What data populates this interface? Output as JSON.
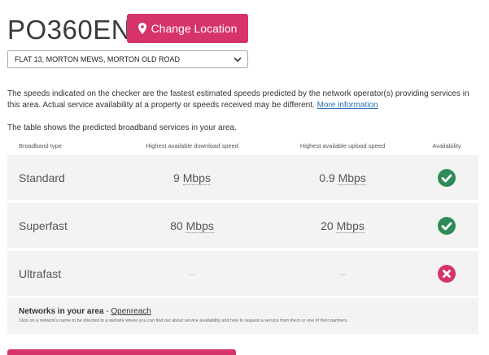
{
  "header": {
    "postcode": "PO360EN",
    "change_location_label": "Change Location",
    "address_selected": "FLAT 13, MORTON MEWS, MORTON OLD ROAD"
  },
  "info": {
    "text": "The speeds indicated on the checker are the fastest estimated speeds predicted by the network operator(s) providing services in this area. Actual service availability at a property or speeds received may be different.",
    "more_link": "More information",
    "table_intro": "The table shows the predicted broadband services in your area."
  },
  "table": {
    "headers": {
      "type": "Broadband type",
      "download": "Highest available download speed",
      "upload": "Highest available upload speed",
      "availability": "Availability"
    },
    "rows": [
      {
        "type": "Standard",
        "down_value": "9",
        "down_unit": "Mbps",
        "up_value": "0.9",
        "up_unit": "Mbps",
        "available": true
      },
      {
        "type": "Superfast",
        "down_value": "80",
        "down_unit": "Mbps",
        "up_value": "20",
        "up_unit": "Mbps",
        "available": true
      },
      {
        "type": "Ultrafast",
        "down_value": "--",
        "down_unit": "",
        "up_value": "--",
        "up_unit": "",
        "available": false
      }
    ]
  },
  "networks": {
    "title": "Networks in your area",
    "separator": " - ",
    "link": "Openreach",
    "note": "Click on a network's name to be directed to a website where you can find out about service availability and how to request a service from them or one of their partners."
  },
  "colors": {
    "accent": "#d6336c",
    "available": "#2e8b57",
    "unavailable": "#d6336c",
    "link": "#2a6fb5"
  },
  "icons": {
    "location": "map-marker-icon",
    "dropdown": "chevron-down-icon",
    "available": "check-circle-icon",
    "unavailable": "x-circle-icon"
  }
}
